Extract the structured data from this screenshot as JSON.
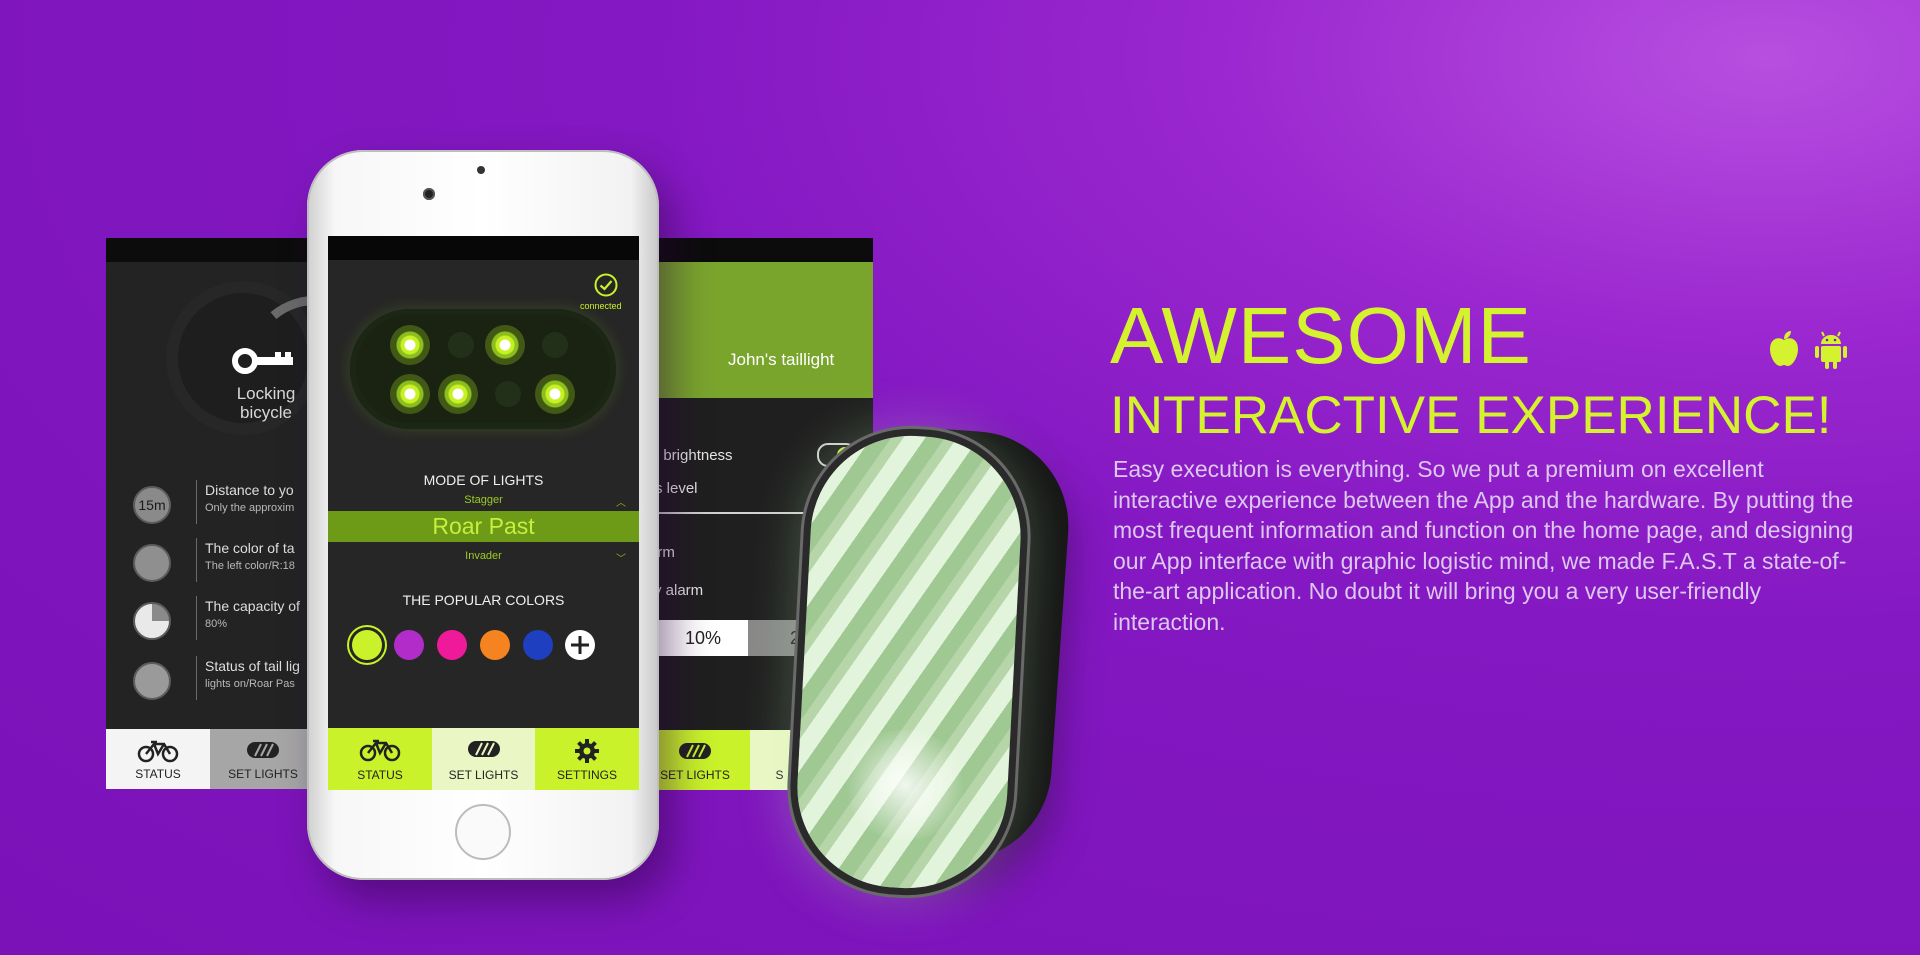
{
  "colors": {
    "accent": "#d4f22e",
    "background": "#8418c2",
    "tab_active": "#c9f22a"
  },
  "marketing": {
    "headline1": "AWESOME",
    "headline2": "INTERACTIVE EXPERIENCE!",
    "body": "Easy execution is everything. So we put a premium on excellent interactive experience between the App and the hardware. By putting the most frequent information and function on the home page, and designing our App interface with graphic logistic mind, we made F.A.S.T a state-of-the-art application. No doubt it will bring you a very user-friendly interaction.",
    "platform_icons": [
      "apple-icon",
      "android-icon"
    ]
  },
  "left_screen": {
    "lock_label_1": "Locking",
    "lock_label_2": "bicycle",
    "stats": [
      {
        "icon": "15m",
        "title": "Distance to yo",
        "sub": "Only the approxim"
      },
      {
        "icon": "color-circle-icon",
        "title": "The color of ta",
        "sub": "The left color/R:18"
      },
      {
        "icon": "battery-pie-icon",
        "title": "The capacity of",
        "sub": "80%"
      },
      {
        "icon": "taillight-icon",
        "title": "Status of tail lig",
        "sub": "lights on/Roar Pas"
      }
    ],
    "tabs": [
      "STATUS",
      "SET LIGHTS"
    ]
  },
  "phone_screen": {
    "connected_label": "connected",
    "mode_title": "MODE OF LIGHTS",
    "mode_prev": "Stagger",
    "mode_selected": "Roar Past",
    "mode_next": "Invader",
    "popular_colors_title": "THE POPULAR COLORS",
    "swatches": [
      "#c9f22a",
      "#b12cc9",
      "#ee1a9a",
      "#f5831f",
      "#1d3fc0"
    ],
    "tabs": [
      "STATUS",
      "SET LIGHTS",
      "SETTINGS"
    ]
  },
  "right_screen": {
    "device_name": "John's taillight",
    "rows": [
      "t brightness",
      "s level",
      "arm",
      "ry alarm"
    ],
    "percent_a": "10%",
    "percent_b": "20",
    "tabs": [
      "SET LIGHTS",
      "S"
    ]
  }
}
